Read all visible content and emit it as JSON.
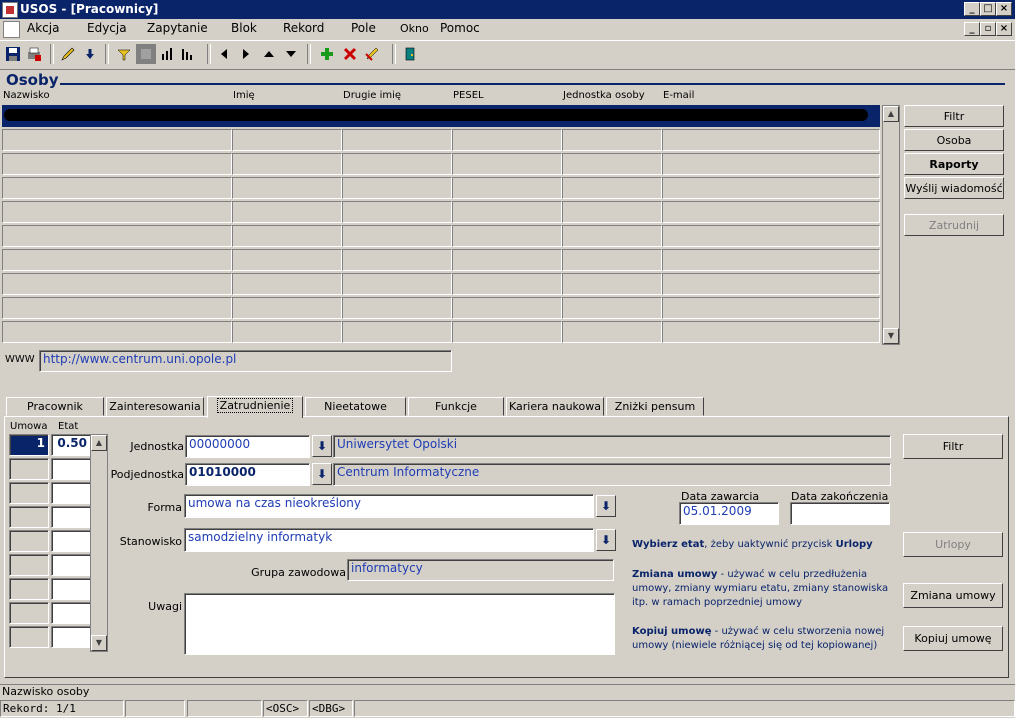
{
  "window": {
    "title": "USOS - [Pracownicy]"
  },
  "menu": [
    "Akcja",
    "Edycja",
    "Zapytanie",
    "Blok",
    "Rekord",
    "Pole",
    "Okno",
    "Pomoc"
  ],
  "block": {
    "title": "Osoby",
    "columns": [
      "Nazwisko",
      "Imię",
      "Drugie imię",
      "PESEL",
      "Jednostka osoby",
      "E-mail"
    ],
    "www_label": "WWW",
    "www_value": "http://www.centrum.uni.opole.pl"
  },
  "side_buttons": {
    "filtr": "Filtr",
    "osoba": "Osoba",
    "raporty": "Raporty",
    "wyslij": "Wyślij wiadomość",
    "zatrudnij": "Zatrudnij"
  },
  "tabs": [
    "Pracownik",
    "Zainteresowania",
    "Zatrudnienie",
    "Nieetatowe",
    "Funkcje",
    "Kariera naukowa",
    "Zniżki pensum"
  ],
  "employment": {
    "umowa_header": "Umowa",
    "etat_header": "Etat",
    "umowa_value": "1",
    "etat_value": "0.50",
    "jednostka_label": "Jednostka",
    "jednostka_code": "00000000",
    "jednostka_name": "Uniwersytet Opolski",
    "podjednostka_label": "Podjednostka",
    "podjednostka_code": "01010000",
    "podjednostka_name": "Centrum Informatyczne",
    "forma_label": "Forma",
    "forma_value": "umowa na czas nieokreślony",
    "stanowisko_label": "Stanowisko",
    "stanowisko_value": "samodzielny informatyk",
    "grupa_label": "Grupa zawodowa",
    "grupa_value": "informatycy",
    "uwagi_label": "Uwagi",
    "uwagi_value": "",
    "data_zawarcia_label": "Data zawarcia",
    "data_zawarcia_value": "05.01.2009",
    "data_zakonczenia_label": "Data zakończenia",
    "data_zakonczenia_value": ""
  },
  "panel_buttons": {
    "filtr": "Filtr",
    "urlopy": "Urlopy",
    "zmiana": "Zmiana umowy",
    "kopiuj": "Kopiuj umowę"
  },
  "notes": {
    "urlopy_bold1": "Wybierz etat",
    "urlopy_text": ", żeby uaktywnić przycisk ",
    "urlopy_bold2": "Urlopy",
    "zmiana_bold": "Zmiana umowy",
    "zmiana_text": " - używać w celu przedłużenia umowy, zmiany wymiaru etatu, zmiany stanowiska itp. w ramach poprzedniej umowy",
    "kopiuj_bold": "Kopiuj umowę",
    "kopiuj_text": " - używać w celu stworzenia nowej umowy (niewiele różniącej się od tej kopiowanej)"
  },
  "status": {
    "hint": "Nazwisko osoby",
    "record": "Rekord: 1/1",
    "osc": "<OSC>",
    "dbg": "<DBG>"
  },
  "colors": {
    "titlebar": "#0a246a",
    "field_text": "#1e3cb4",
    "bg": "#d4d0c8"
  }
}
